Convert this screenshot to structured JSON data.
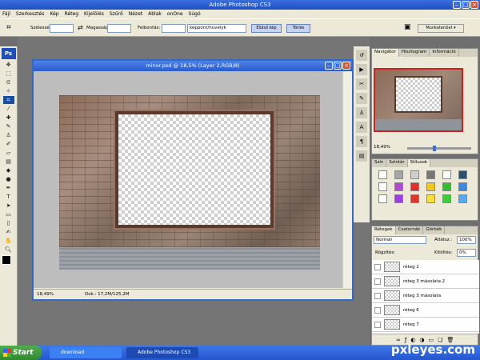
{
  "app": {
    "title": "Adobe Photoshop CS3",
    "controls": [
      "–",
      "□",
      "×"
    ]
  },
  "menu": [
    "Fájl",
    "Szerkesztés",
    "Kép",
    "Réteg",
    "Kijelölés",
    "Szűrő",
    "Nézet",
    "Ablak",
    "onOne",
    "Súgó"
  ],
  "options": {
    "width_label": "Szélesség:",
    "height_label": "Magasság:",
    "resolution_label": "Felbontás:",
    "unit_select": "képpont/hüvelyk",
    "front_image_button": "Elülső kép",
    "clear_button": "Törlés",
    "workspace_label": "Munkaterület ▾"
  },
  "document": {
    "title": "minor.psd @ 18,5% (Layer 2,RGB/8)",
    "zoom": "18,49%",
    "doc_size": "Dok.: 17,2M/125,2M"
  },
  "navigator": {
    "tabs": [
      "Navigátor",
      "Hisztogram",
      "Információ"
    ],
    "zoom": "18,49%",
    "slider_fraction": 0.4
  },
  "styles": {
    "tabs": [
      "Szín",
      "Színtár",
      "Stílusok"
    ],
    "swatch_colors": [
      "#ffffff",
      "#a5a5a5",
      "#cfcfcf",
      "#777777",
      "#ffffff",
      "#2d4f6e",
      "#ffffff",
      "#b24ad0",
      "#e02f2f",
      "#f0c81a",
      "#33bb33",
      "#3a88e0",
      "#ffffff",
      "#9a3fe0",
      "#d8382a",
      "#f7e03a",
      "#3ccc3c",
      "#58a8f0"
    ]
  },
  "layers": {
    "tabs": [
      "Rétegek",
      "Csatornák",
      "Görbék"
    ],
    "blend_mode": "Normál",
    "opacity_label": "Átlátsz.:",
    "opacity": "100%",
    "lock_label": "Rögzítés:",
    "fill_label": "Kitöltés:",
    "fill": "0%",
    "items": [
      "réteg 2",
      "réteg 3 másolata 2",
      "réteg 3 másolata",
      "réteg 6",
      "réteg 7"
    ]
  },
  "taskbar": {
    "start": "Start",
    "tasks": [
      "download",
      "Adobe Photoshop CS3"
    ]
  },
  "watermark": "pxleyes.com"
}
